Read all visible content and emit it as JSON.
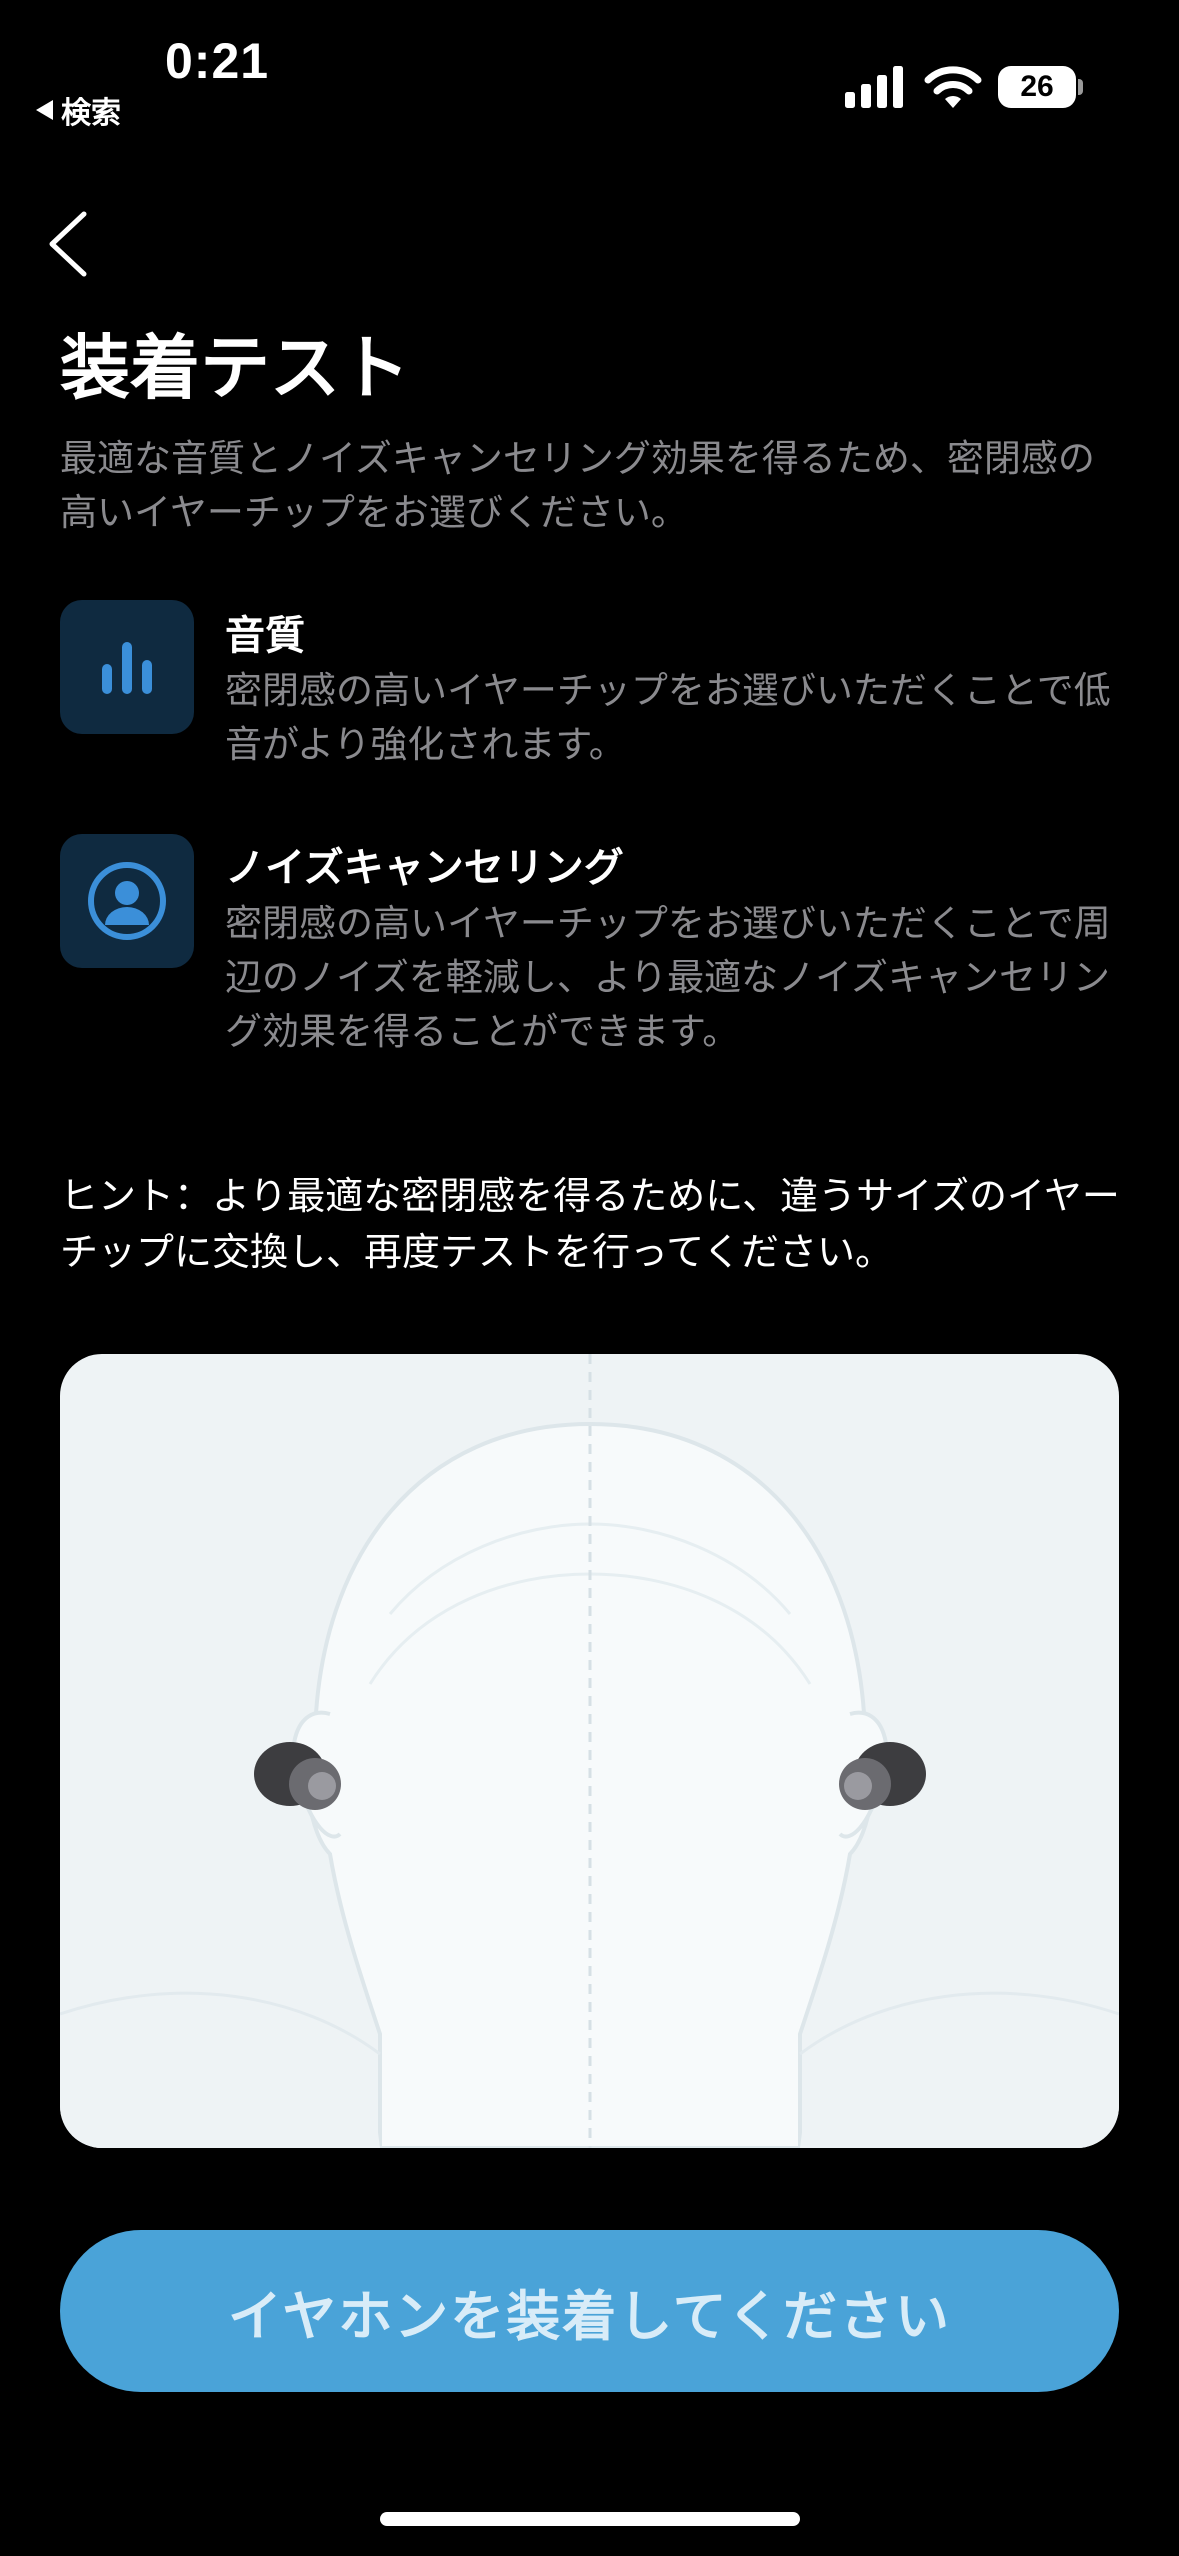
{
  "status_bar": {
    "time": "0:21",
    "back_app": "検索",
    "battery": "26"
  },
  "header": {
    "title": "装着テスト",
    "description": "最適な音質とノイズキャンセリング効果を得るため、密閉感の高いイヤーチップをお選びください。"
  },
  "features": [
    {
      "icon": "equalizer-bars-icon",
      "title": "音質",
      "text": "密閉感の高いイヤーチップをお選びいただくことで低音がより強化されます。"
    },
    {
      "icon": "person-noise-cancel-icon",
      "title": "ノイズキャンセリング",
      "text": "密閉感の高いイヤーチップをお選びいただくことで周辺のノイズを軽減し、より最適なノイズキャンセリング効果を得ることができます。"
    }
  ],
  "hint": "ヒント：より最適な密閉感を得るために、違うサイズのイヤーチップに交換し、再度テストを行ってください。",
  "illustration": {
    "subject": "head-with-earbuds-illustration"
  },
  "cta": {
    "label": "イヤホンを装着してください"
  },
  "colors": {
    "background": "#000000",
    "accent": "#4aa3d8",
    "icon_tile": "#0f2a40",
    "icon_blue": "#3b8fd9",
    "muted_text": "#8a8a8e"
  }
}
